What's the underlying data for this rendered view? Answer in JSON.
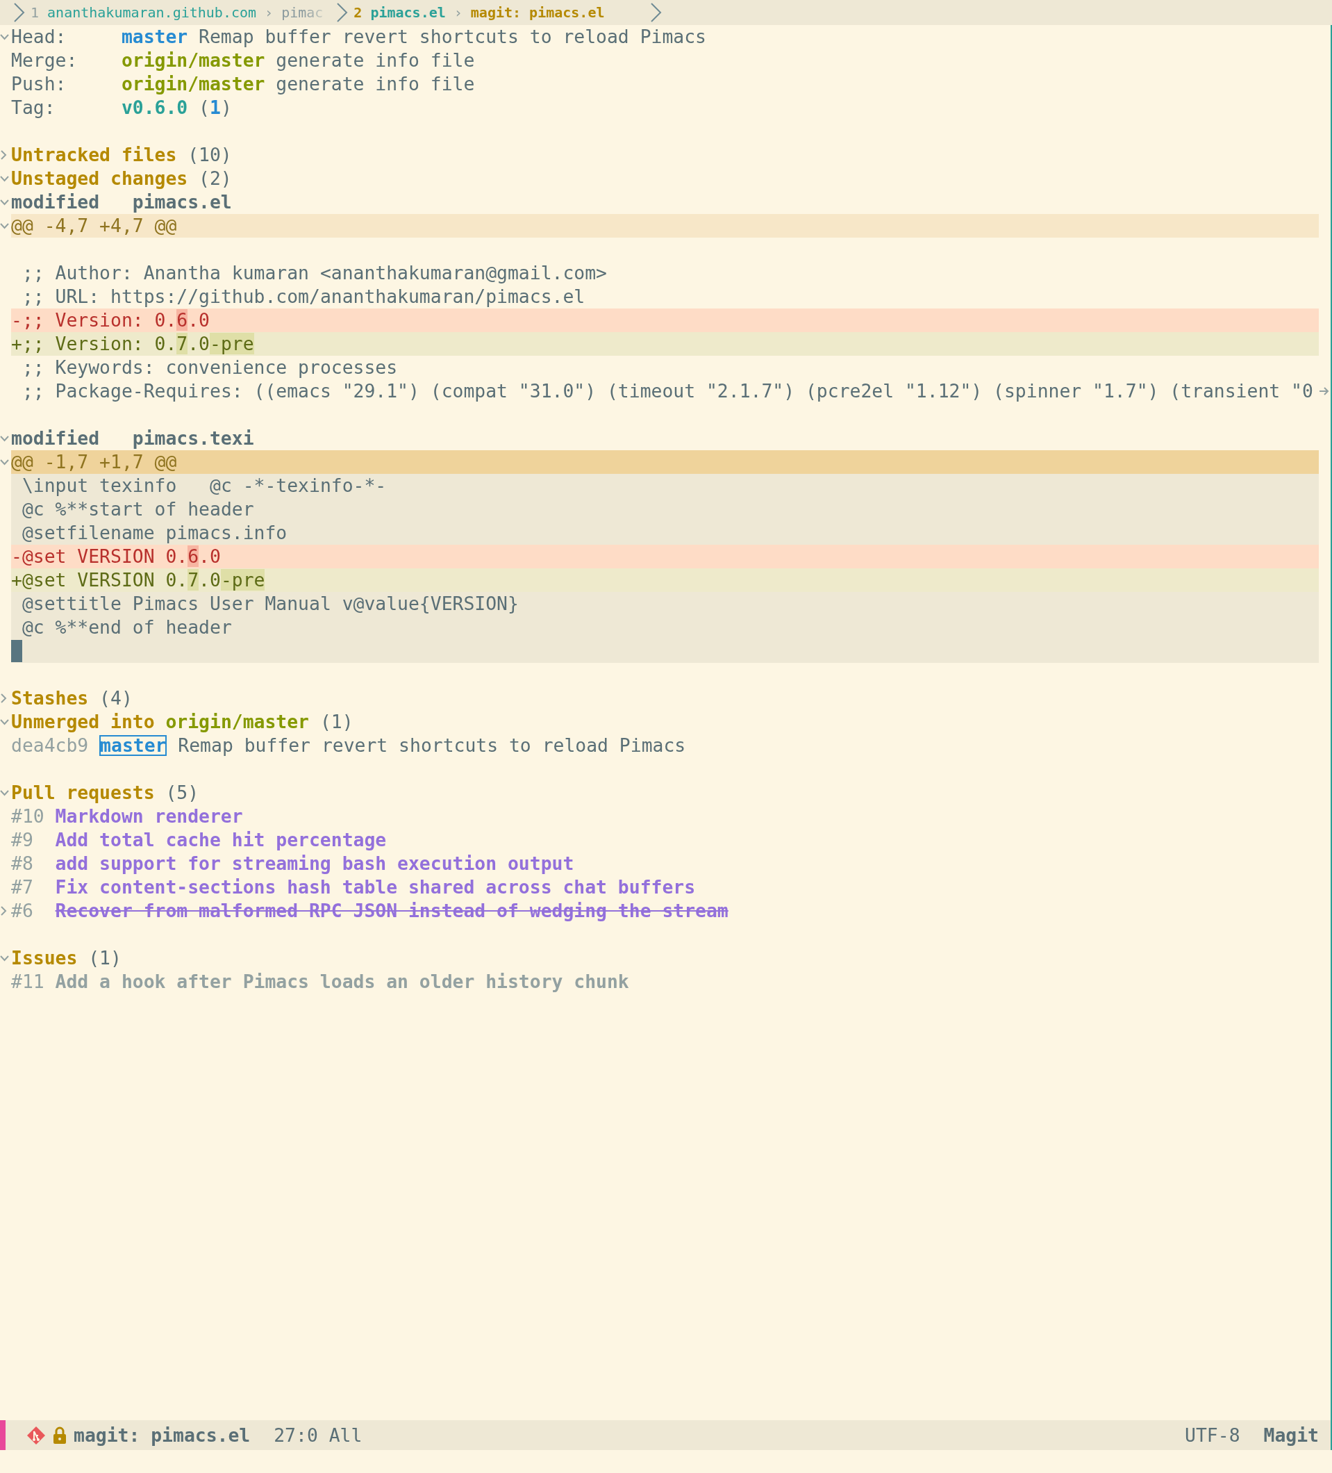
{
  "tab_bar": {
    "separator": "›",
    "tabs": [
      {
        "number": "1",
        "parts": [
          "ananthakumaran.github.com",
          "pimac"
        ],
        "selected": false
      },
      {
        "number": "2",
        "parts": [
          "pimacs.el",
          "magit: pimacs.el"
        ],
        "selected": true
      }
    ]
  },
  "lines": [
    {
      "kind": "section",
      "expanded": true,
      "spans": [
        {
          "text": "Head:",
          "kind": "label"
        },
        {
          "text": "master",
          "kind": "local-branch"
        },
        {
          "text": "Remap buffer revert shortcuts to reload Pimacs",
          "kind": "message"
        }
      ]
    },
    {
      "kind": "section",
      "spans": [
        {
          "text": "Merge:",
          "kind": "label"
        },
        {
          "text": "origin/master",
          "kind": "remote-branch"
        },
        {
          "text": "generate info file",
          "kind": "message"
        }
      ]
    },
    {
      "kind": "section",
      "spans": [
        {
          "text": "Push:",
          "kind": "label"
        },
        {
          "text": "origin/master",
          "kind": "remote-branch"
        },
        {
          "text": "generate info file",
          "kind": "message"
        }
      ]
    },
    {
      "kind": "section",
      "spans": [
        {
          "text": "Tag:",
          "kind": "label"
        },
        {
          "text": "v0.6.0",
          "kind": "tag"
        },
        {
          "text": "(",
          "kind": "paren-open"
        },
        {
          "text": "1",
          "kind": "tag-count"
        },
        {
          "text": ")",
          "kind": "paren-close"
        }
      ]
    },
    {
      "kind": "blank"
    },
    {
      "kind": "section",
      "expanded": false,
      "spans": [
        {
          "text": "Untracked files",
          "kind": "heading"
        },
        {
          "text": "(10)",
          "kind": "count"
        }
      ]
    },
    {
      "kind": "section",
      "expanded": true,
      "spans": [
        {
          "text": "Unstaged changes",
          "kind": "heading"
        },
        {
          "text": "(2)",
          "kind": "count"
        }
      ]
    },
    {
      "kind": "section",
      "expanded": true,
      "spans": [
        {
          "text": "modified",
          "kind": "file-status"
        },
        {
          "text": "pimacs.el",
          "kind": "file-name"
        }
      ]
    },
    {
      "kind": "hunk-header",
      "expanded": true,
      "selected": false,
      "spans": [
        {
          "text": "@@ -4,7 +4,7 @@"
        }
      ]
    },
    {
      "kind": "context",
      "selected": false
    },
    {
      "kind": "context",
      "selected": false,
      "spans": [
        {
          "text": " ;; Author: Anantha kumaran <ananthakumaran@gmail.com>"
        }
      ]
    },
    {
      "kind": "context",
      "selected": false,
      "spans": [
        {
          "text": " ;; URL: https://github.com/ananthakumaran/pimacs.el"
        }
      ]
    },
    {
      "kind": "removed",
      "spans": [
        {
          "text": "-;; Version: 0.",
          "refine": false
        },
        {
          "text": "6",
          "refine": true
        },
        {
          "text": ".0",
          "refine": false
        }
      ]
    },
    {
      "kind": "added",
      "spans": [
        {
          "text": "+;; Version: 0.",
          "refine": false
        },
        {
          "text": "7",
          "refine": true
        },
        {
          "text": ".0",
          "refine": false
        },
        {
          "text": "-pre",
          "refine": true
        }
      ]
    },
    {
      "kind": "context",
      "selected": false,
      "spans": [
        {
          "text": " ;; Keywords: convenience processes"
        }
      ]
    },
    {
      "kind": "context",
      "selected": false,
      "truncated": true,
      "spans": [
        {
          "text": " ;; Package-Requires: ((emacs \"29.1\") (compat \"31.0\") (timeout \"2.1.7\") (pcre2el \"1.12\") (spinner \"1.7\") (transient \"0"
        }
      ]
    },
    {
      "kind": "blank"
    },
    {
      "kind": "section",
      "expanded": true,
      "spans": [
        {
          "text": "modified",
          "kind": "file-status"
        },
        {
          "text": "pimacs.texi",
          "kind": "file-name"
        }
      ]
    },
    {
      "kind": "hunk-header",
      "expanded": true,
      "selected": true,
      "spans": [
        {
          "text": "@@ -1,7 +1,7 @@"
        }
      ]
    },
    {
      "kind": "context",
      "selected": true,
      "spans": [
        {
          "text": " \\input texinfo   @c -*-texinfo-*-"
        }
      ]
    },
    {
      "kind": "context",
      "selected": true,
      "spans": [
        {
          "text": " @c %**start of header"
        }
      ]
    },
    {
      "kind": "context",
      "selected": true,
      "spans": [
        {
          "text": " @setfilename pimacs.info"
        }
      ]
    },
    {
      "kind": "removed",
      "spans": [
        {
          "text": "-@set VERSION 0.",
          "refine": false
        },
        {
          "text": "6",
          "refine": true
        },
        {
          "text": ".0",
          "refine": false
        }
      ]
    },
    {
      "kind": "added",
      "spans": [
        {
          "text": "+@set VERSION 0.",
          "refine": false
        },
        {
          "text": "7",
          "refine": true
        },
        {
          "text": ".0",
          "refine": false
        },
        {
          "text": "-pre",
          "refine": true
        }
      ]
    },
    {
      "kind": "context",
      "selected": true,
      "spans": [
        {
          "text": " @settitle Pimacs User Manual v@value{VERSION}"
        }
      ]
    },
    {
      "kind": "context",
      "selected": true,
      "spans": [
        {
          "text": " @c %**end of header"
        }
      ]
    },
    {
      "kind": "context",
      "selected": true,
      "cursor": true
    },
    {
      "kind": "blank"
    },
    {
      "kind": "section",
      "expanded": false,
      "spans": [
        {
          "text": "Stashes",
          "kind": "heading"
        },
        {
          "text": "(4)",
          "kind": "count"
        }
      ]
    },
    {
      "kind": "section",
      "expanded": true,
      "spans": [
        {
          "text": "Unmerged into",
          "kind": "heading"
        },
        {
          "text": "origin/master",
          "kind": "remote-branch"
        },
        {
          "text": "(1)",
          "kind": "count"
        }
      ]
    },
    {
      "kind": "section",
      "spans": [
        {
          "text": "dea4cb9",
          "kind": "hash"
        },
        {
          "text": "master",
          "kind": "branch-boxed"
        },
        {
          "text": "Remap buffer revert shortcuts to reload Pimacs",
          "kind": "message"
        }
      ]
    },
    {
      "kind": "blank"
    },
    {
      "kind": "section",
      "expanded": true,
      "spans": [
        {
          "text": "Pull requests",
          "kind": "heading"
        },
        {
          "text": "(5)",
          "kind": "count"
        }
      ]
    },
    {
      "kind": "section",
      "closed": false,
      "spans": [
        {
          "text": "#10",
          "kind": "pr-number"
        },
        {
          "text": "Markdown renderer",
          "kind": "pr-title"
        }
      ]
    },
    {
      "kind": "section",
      "closed": false,
      "spans": [
        {
          "text": "#9",
          "kind": "pr-number"
        },
        {
          "text": "Add total cache hit percentage",
          "kind": "pr-title"
        }
      ]
    },
    {
      "kind": "section",
      "closed": false,
      "spans": [
        {
          "text": "#8",
          "kind": "pr-number"
        },
        {
          "text": "add support for streaming bash execution output",
          "kind": "pr-title"
        }
      ]
    },
    {
      "kind": "section",
      "closed": false,
      "spans": [
        {
          "text": "#7",
          "kind": "pr-number"
        },
        {
          "text": "Fix content-sections hash table shared across chat buffers",
          "kind": "pr-title"
        }
      ]
    },
    {
      "kind": "section",
      "closed": true,
      "expanded": false,
      "spans": [
        {
          "text": "#6",
          "kind": "pr-number"
        },
        {
          "text": "Recover from malformed RPC JSON instead of wedging the stream",
          "kind": "pr-title"
        }
      ]
    },
    {
      "kind": "blank"
    },
    {
      "kind": "section",
      "expanded": true,
      "spans": [
        {
          "text": "Issues",
          "kind": "heading"
        },
        {
          "text": "(1)",
          "kind": "count"
        }
      ]
    },
    {
      "kind": "section",
      "spans": [
        {
          "text": "#11",
          "kind": "issue-number"
        },
        {
          "text": "Add a hook after Pimacs loads an older history chunk",
          "kind": "issue-title"
        }
      ]
    }
  ],
  "mode_line": {
    "buffer_name": "magit: pimacs.el",
    "position": "27:0 All",
    "encoding": "UTF-8",
    "mode": "Magit"
  }
}
